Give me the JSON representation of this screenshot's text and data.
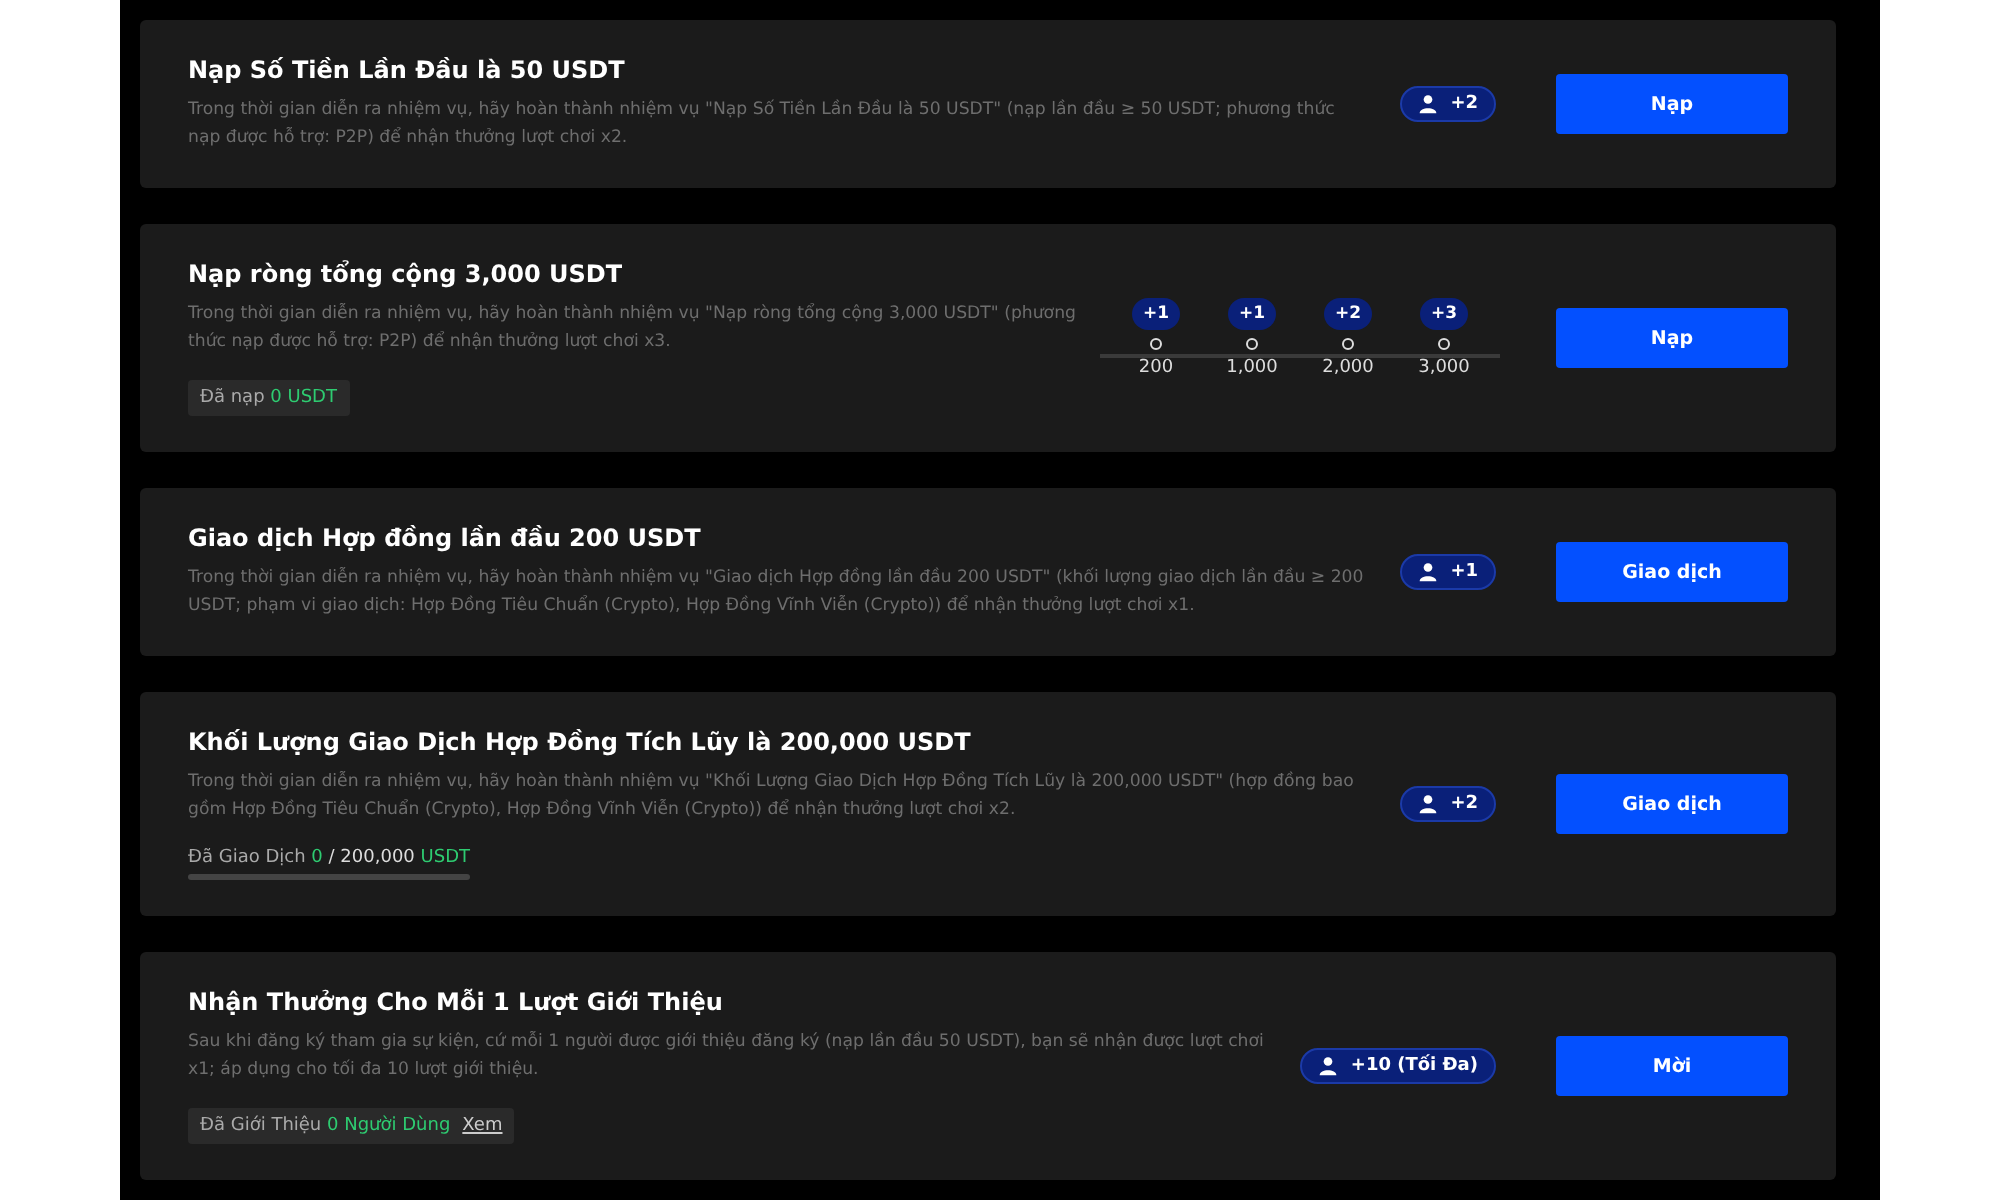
{
  "tasks": [
    {
      "title": "Nạp Số Tiền Lần Đầu là 50 USDT",
      "description": "Trong thời gian diễn ra nhiệm vụ, hãy hoàn thành nhiệm vụ \"Nạp Số Tiền Lần Đầu là 50 USDT\" (nạp lần đầu ≥ 50 USDT; phương thức nạp được hỗ trợ: P2P) để nhận thưởng lượt chơi x2.",
      "reward": {
        "kind": "chip",
        "label": "+2"
      },
      "button": "Nạp"
    },
    {
      "title": "Nạp ròng tổng cộng 3,000 USDT",
      "description": "Trong thời gian diễn ra nhiệm vụ, hãy hoàn thành nhiệm vụ \"Nạp ròng tổng cộng 3,000 USDT\" (phương thức nạp được hỗ trợ: P2P) để nhận thưởng lượt chơi x3.",
      "progress": {
        "kind": "badge",
        "parts": [
          {
            "kind": "text",
            "text": "Đã nạp"
          },
          {
            "kind": "value",
            "text": "0 USDT"
          }
        ]
      },
      "reward": {
        "kind": "milestones",
        "steps": [
          {
            "label": "+1",
            "amount": "200"
          },
          {
            "label": "+1",
            "amount": "1,000"
          },
          {
            "label": "+2",
            "amount": "2,000"
          },
          {
            "label": "+3",
            "amount": "3,000"
          }
        ]
      },
      "button": "Nạp"
    },
    {
      "title": "Giao dịch Hợp đồng lần đầu 200 USDT",
      "description": "Trong thời gian diễn ra nhiệm vụ, hãy hoàn thành nhiệm vụ \"Giao dịch Hợp đồng lần đầu 200 USDT\" (khối lượng giao dịch lần đầu ≥ 200 USDT; phạm vi giao dịch: Hợp Đồng Tiêu Chuẩn (Crypto), Hợp Đồng Vĩnh Viễn (Crypto)) để nhận thưởng lượt chơi x1.",
      "reward": {
        "kind": "chip",
        "label": "+1"
      },
      "button": "Giao dịch"
    },
    {
      "title": "Khối Lượng Giao Dịch Hợp Đồng Tích Lũy là 200,000 USDT",
      "description": "Trong thời gian diễn ra nhiệm vụ, hãy hoàn thành nhiệm vụ \"Khối Lượng Giao Dịch Hợp Đồng Tích Lũy là 200,000 USDT\" (hợp đồng bao gồm Hợp Đồng Tiêu Chuẩn (Crypto), Hợp Đồng Vĩnh Viễn (Crypto)) để nhận thưởng lượt chơi x2.",
      "progress": {
        "kind": "bar",
        "level": 0,
        "parts": [
          {
            "kind": "text",
            "text": "Đã Giao Dịch"
          },
          {
            "kind": "value",
            "text": "0"
          },
          {
            "kind": "plain",
            "text": "/ 200,000"
          },
          {
            "kind": "value",
            "text": "USDT"
          }
        ]
      },
      "reward": {
        "kind": "chip",
        "label": "+2"
      },
      "button": "Giao dịch"
    },
    {
      "title": "Nhận Thưởng Cho Mỗi 1 Lượt Giới Thiệu",
      "description": "Sau khi đăng ký tham gia sự kiện, cứ mỗi 1 người được giới thiệu đăng ký (nạp lần đầu 50 USDT), bạn sẽ nhận được lượt chơi x1; áp dụng cho tối đa 10 lượt giới thiệu.",
      "progress": {
        "kind": "badge",
        "parts": [
          {
            "kind": "text",
            "text": "Đã Giới Thiệu"
          },
          {
            "kind": "value",
            "text": "0 Người Dùng"
          }
        ],
        "link": "Xem"
      },
      "reward": {
        "kind": "chip",
        "label": "+10 (Tối Đa)"
      },
      "button": "Mời"
    }
  ]
}
